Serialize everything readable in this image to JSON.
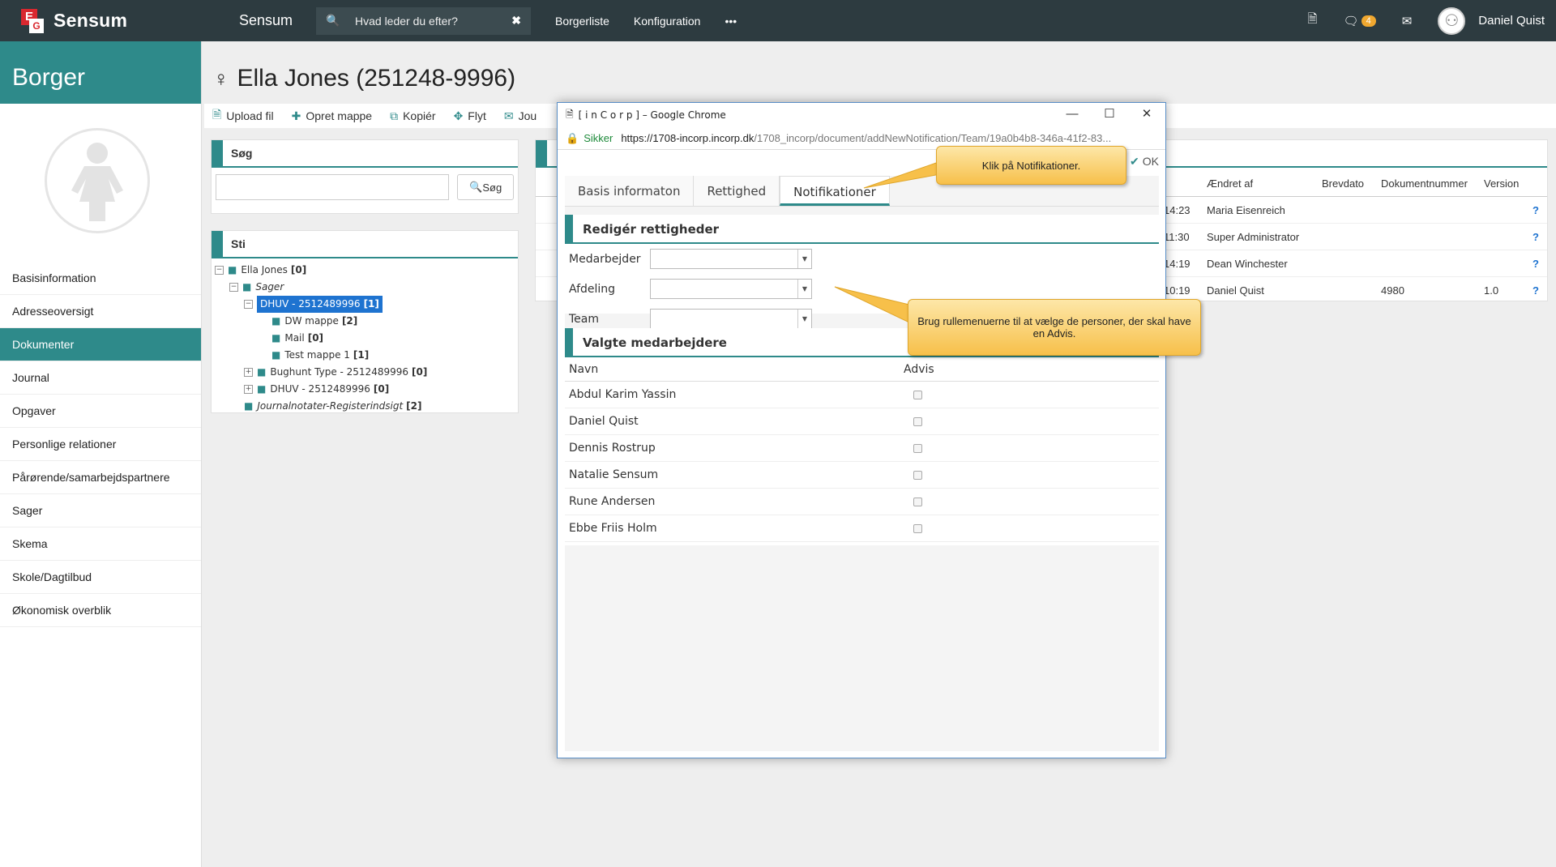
{
  "topbar": {
    "logo_text": "Sensum",
    "app_name": "Sensum",
    "search_placeholder": "Hvad leder du efter?",
    "nav": [
      "Borgerliste",
      "Konfiguration",
      "•••"
    ],
    "notification_count": "4",
    "user_name": "Daniel Quist"
  },
  "sidebar": {
    "title": "Borger",
    "items": [
      {
        "label": "Basisinformation"
      },
      {
        "label": "Adresseoversigt"
      },
      {
        "label": "Dokumenter"
      },
      {
        "label": "Journal"
      },
      {
        "label": "Opgaver"
      },
      {
        "label": "Personlige relationer"
      },
      {
        "label": "Pårørende/samarbejdspartnere"
      },
      {
        "label": "Sager"
      },
      {
        "label": "Skema"
      },
      {
        "label": "Skole/Dagtilbud"
      },
      {
        "label": "Økonomisk overblik"
      }
    ],
    "active_index": 2
  },
  "page": {
    "title": "Ella Jones (251248-9996)"
  },
  "toolbar": {
    "upload": "Upload fil",
    "create_folder": "Opret mappe",
    "copy": "Kopiér",
    "move": "Flyt",
    "journal": "Jou"
  },
  "search_panel": {
    "title": "Søg",
    "button": "Søg"
  },
  "path_panel": {
    "title": "Sti",
    "tree": {
      "root": {
        "label": "Ella Jones",
        "count": "[0]"
      },
      "sager": {
        "label": "Sager"
      },
      "dhuv_selected": {
        "label": "DHUV - 2512489996",
        "count": "[1]"
      },
      "dw": {
        "label": "DW mappe",
        "count": "[2]"
      },
      "mail": {
        "label": "Mail",
        "count": "[0]"
      },
      "test": {
        "label": "Test mappe 1",
        "count": "[1]"
      },
      "bughunt": {
        "label": "Bughunt Type - 2512489996",
        "count": "[0]"
      },
      "dhuv2": {
        "label": "DHUV - 2512489996",
        "count": "[0]"
      },
      "journal": {
        "label": "Journalnotater-Registerindsigt",
        "count": "[2]"
      }
    }
  },
  "doc_table": {
    "columns": {
      "changed_by": "Ændret af",
      "letter_date": "Brevdato",
      "doc_number": "Dokumentnummer",
      "version": "Version"
    },
    "rows": [
      {
        "time": "14:23",
        "changed_by": "Maria Eisenreich",
        "doc_number": "",
        "version": "",
        "help": "?"
      },
      {
        "time": "11:30",
        "changed_by": "Super Administrator",
        "doc_number": "",
        "version": "",
        "help": "?"
      },
      {
        "time": "14:19",
        "changed_by": "Dean Winchester",
        "doc_number": "",
        "version": "",
        "help": "?"
      },
      {
        "time": "10:19",
        "changed_by": "Daniel Quist",
        "doc_number": "4980",
        "version": "1.0",
        "help": "?"
      }
    ]
  },
  "popup": {
    "window_title": "[ i n C o r p ] – Google Chrome",
    "secure_label": "Sikker",
    "url_host": "https://1708-incorp.incorp.dk",
    "url_path": "/1708_incorp/document/addNewNotification/Team/19a0b4b8-346a-41f2-83...",
    "ok_label": "OK",
    "tabs": [
      "Basis informaton",
      "Rettighed",
      "Notifikationer"
    ],
    "active_tab": 2,
    "rights_section": {
      "title": "Redigér rettigheder",
      "fields": [
        {
          "label": "Medarbejder",
          "value": ""
        },
        {
          "label": "Afdeling",
          "value": ""
        },
        {
          "label": "Team",
          "value": ""
        }
      ]
    },
    "selected_section": {
      "title": "Valgte medarbejdere",
      "col_name": "Navn",
      "col_advis": "Advis",
      "rows": [
        {
          "name": "Abdul Karim Yassin",
          "advis": false
        },
        {
          "name": "Daniel Quist",
          "advis": false
        },
        {
          "name": "Dennis Rostrup",
          "advis": false
        },
        {
          "name": "Natalie Sensum",
          "advis": false
        },
        {
          "name": "Rune Andersen",
          "advis": false
        },
        {
          "name": "Ebbe Friis Holm",
          "advis": false
        }
      ]
    }
  },
  "callouts": {
    "tab_hint": "Klik på Notifikationer.",
    "dropdown_hint": "Brug rullemenuerne til at vælge de personer, der skal have en Advis."
  }
}
